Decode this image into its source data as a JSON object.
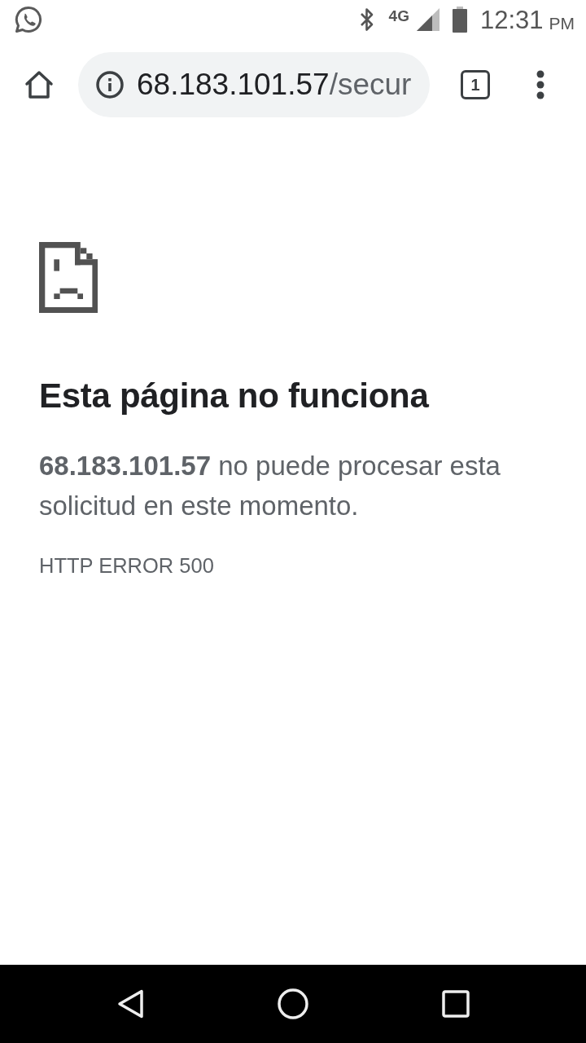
{
  "status_bar": {
    "network": "4G",
    "time": "12:31",
    "am_pm": "PM"
  },
  "browser_toolbar": {
    "url_host": "68.183.101.57",
    "url_path": "/secur",
    "tab_count": "1"
  },
  "error_page": {
    "title": "Esta página no funciona",
    "message": "**68.183.101.57** no puede procesar esta solicitud en este momento.",
    "error_code": "HTTP ERROR 500"
  }
}
